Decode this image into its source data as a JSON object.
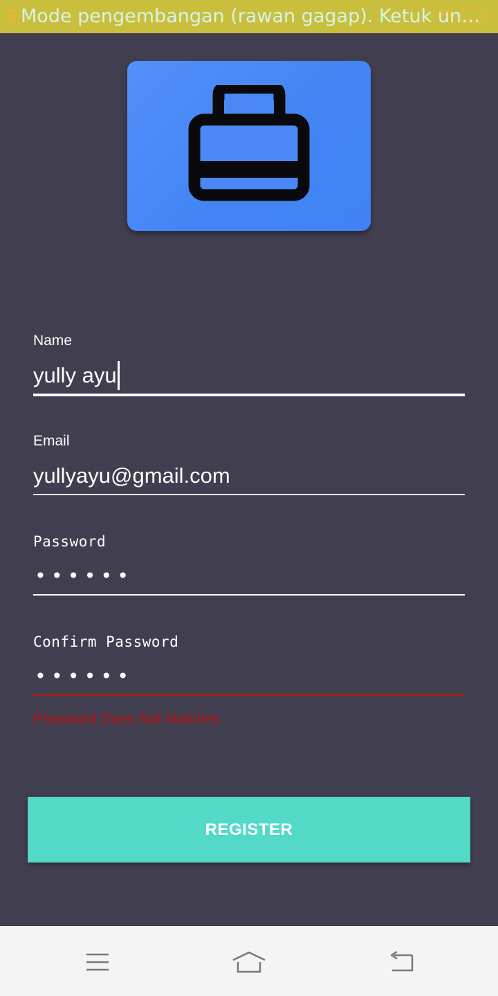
{
  "status_bar": {
    "carrier": "E",
    "banner_text": "Mode pengembangan (rawan gagap). Ketuk untuk m…",
    "icons": [
      "signal-icon",
      "wifi-icon",
      "battery-icon"
    ]
  },
  "logo": {
    "icon": "briefcase-icon",
    "color": "#4385f4"
  },
  "form": {
    "name": {
      "label": "Name",
      "value": "yully ayu"
    },
    "email": {
      "label": "Email",
      "value": "yullyayu@gmail.com"
    },
    "password": {
      "label": "Password",
      "value": "••••••"
    },
    "confirm_password": {
      "label": "Confirm Password",
      "value": "••••••",
      "error": "Password Does Not Matches"
    }
  },
  "register_button": {
    "label": "REGISTER",
    "color": "#52d9c8"
  },
  "nav_bar": {
    "buttons": [
      "menu-icon",
      "home-icon",
      "back-icon"
    ]
  },
  "colors": {
    "background": "#413e4f",
    "error": "#b71010",
    "status_bar": "#c9bf3d"
  }
}
